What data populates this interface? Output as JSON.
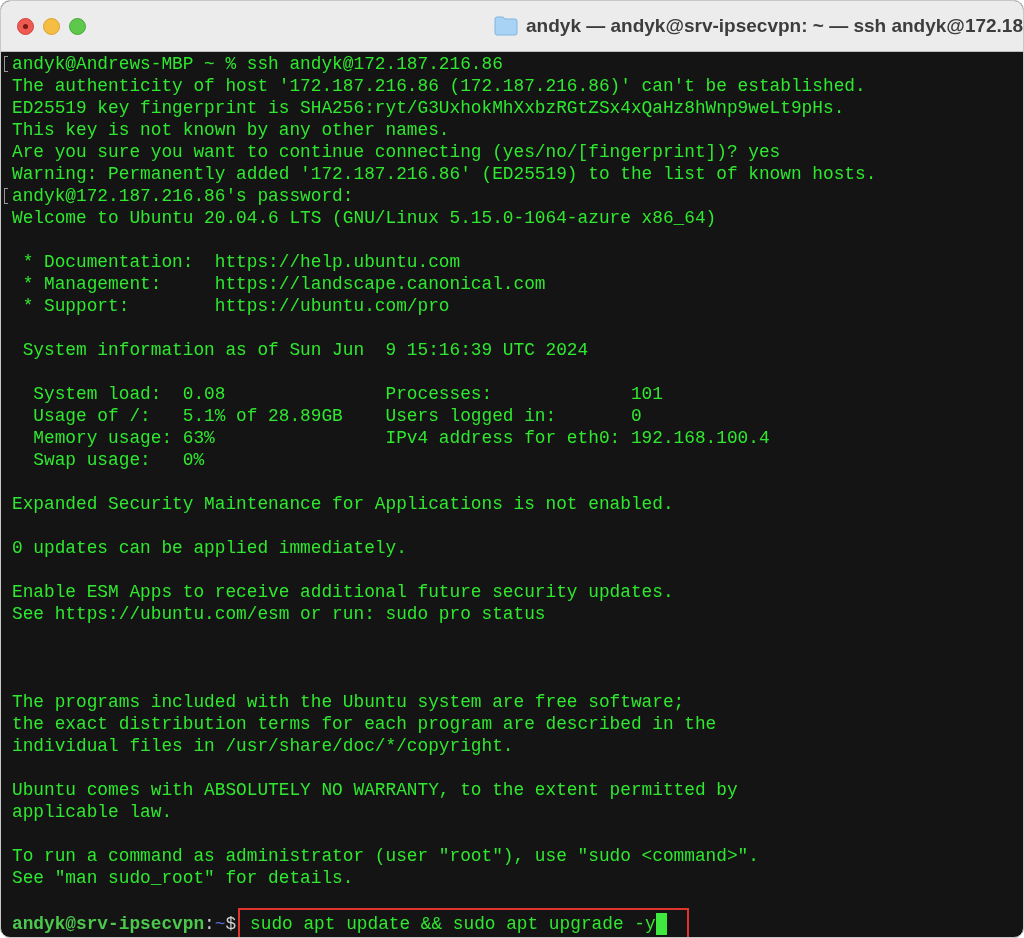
{
  "window": {
    "title": "andyk — andyk@srv-ipsecvpn: ~ — ssh andyk@172.18"
  },
  "lines": [
    {
      "kind": "text",
      "text": "andyk@Andrews-MBP ~ % ssh andyk@172.187.216.86",
      "marked": true
    },
    {
      "kind": "text",
      "text": "The authenticity of host '172.187.216.86 (172.187.216.86)' can't be established.",
      "marked": false
    },
    {
      "kind": "text",
      "text": "ED25519 key fingerprint is SHA256:ryt/G3UxhokMhXxbzRGtZSx4xQaHz8hWnp9weLt9pHs.",
      "marked": false
    },
    {
      "kind": "text",
      "text": "This key is not known by any other names.",
      "marked": false
    },
    {
      "kind": "text",
      "text": "Are you sure you want to continue connecting (yes/no/[fingerprint])? yes",
      "marked": false
    },
    {
      "kind": "text",
      "text": "Warning: Permanently added '172.187.216.86' (ED25519) to the list of known hosts.",
      "marked": false
    },
    {
      "kind": "text",
      "text": "andyk@172.187.216.86's password:",
      "marked": true
    },
    {
      "kind": "text",
      "text": "Welcome to Ubuntu 20.04.6 LTS (GNU/Linux 5.15.0-1064-azure x86_64)",
      "marked": false
    },
    {
      "kind": "blank"
    },
    {
      "kind": "text",
      "text": " * Documentation:  https://help.ubuntu.com",
      "marked": false
    },
    {
      "kind": "text",
      "text": " * Management:     https://landscape.canonical.com",
      "marked": false
    },
    {
      "kind": "text",
      "text": " * Support:        https://ubuntu.com/pro",
      "marked": false
    },
    {
      "kind": "blank"
    },
    {
      "kind": "text",
      "text": " System information as of Sun Jun  9 15:16:39 UTC 2024",
      "marked": false
    },
    {
      "kind": "blank"
    },
    {
      "kind": "text",
      "text": "  System load:  0.08               Processes:             101",
      "marked": false
    },
    {
      "kind": "text",
      "text": "  Usage of /:   5.1% of 28.89GB    Users logged in:       0",
      "marked": false
    },
    {
      "kind": "text",
      "text": "  Memory usage: 63%                IPv4 address for eth0: 192.168.100.4",
      "marked": false
    },
    {
      "kind": "text",
      "text": "  Swap usage:   0%",
      "marked": false
    },
    {
      "kind": "blank"
    },
    {
      "kind": "text",
      "text": "Expanded Security Maintenance for Applications is not enabled.",
      "marked": false
    },
    {
      "kind": "blank"
    },
    {
      "kind": "text",
      "text": "0 updates can be applied immediately.",
      "marked": false
    },
    {
      "kind": "blank"
    },
    {
      "kind": "text",
      "text": "Enable ESM Apps to receive additional future security updates.",
      "marked": false
    },
    {
      "kind": "text",
      "text": "See https://ubuntu.com/esm or run: sudo pro status",
      "marked": false
    },
    {
      "kind": "blank"
    },
    {
      "kind": "blank"
    },
    {
      "kind": "blank"
    },
    {
      "kind": "text",
      "text": "The programs included with the Ubuntu system are free software;",
      "marked": false
    },
    {
      "kind": "text",
      "text": "the exact distribution terms for each program are described in the",
      "marked": false
    },
    {
      "kind": "text",
      "text": "individual files in /usr/share/doc/*/copyright.",
      "marked": false
    },
    {
      "kind": "blank"
    },
    {
      "kind": "text",
      "text": "Ubuntu comes with ABSOLUTELY NO WARRANTY, to the extent permitted by",
      "marked": false
    },
    {
      "kind": "text",
      "text": "applicable law.",
      "marked": false
    },
    {
      "kind": "blank"
    },
    {
      "kind": "text",
      "text": "To run a command as administrator (user \"root\"), use \"sudo <command>\".",
      "marked": false
    },
    {
      "kind": "text",
      "text": "See \"man sudo_root\" for details.",
      "marked": false
    },
    {
      "kind": "blank"
    }
  ],
  "prompt": {
    "user_host": "andyk@srv-ipsecvpn",
    "separator": ":",
    "path": "~",
    "symbol": "$",
    "command": "sudo apt update && sudo apt upgrade -y",
    "highlighted": true
  }
}
